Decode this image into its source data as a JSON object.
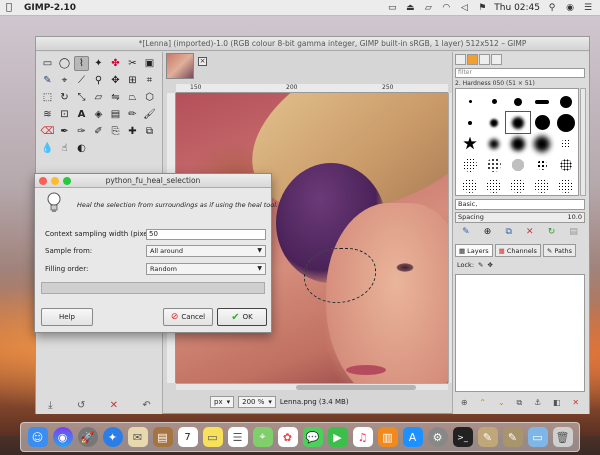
{
  "menubar": {
    "app_name": "GIMP-2.10",
    "clock": "Thu 02:45",
    "icons": [
      "apple-icon",
      "screen-icon",
      "eject-icon",
      "airplay-icon",
      "wifi-icon",
      "volume-icon",
      "flag-icon",
      "search-icon",
      "siri-icon",
      "list-icon"
    ]
  },
  "gimp": {
    "title": "*[Lenna] (imported)-1.0 (RGB colour 8-bit gamma integer, GIMP built-in sRGB, 1 layer) 512x512 – GIMP",
    "ruler_ticks": [
      "150",
      "200",
      "250"
    ],
    "status": {
      "unit": "px",
      "zoom": "200 %",
      "file_info": "Lenna.png (3.4 MB)"
    }
  },
  "toolbox": {
    "tools": [
      "rect-select-icon",
      "ellipse-select-icon",
      "free-select-icon",
      "fuzzy-select-icon",
      "color-select-icon",
      "scissors-icon",
      "foreground-select-icon",
      "paths-icon",
      "color-picker-icon",
      "measure-icon",
      "zoom-icon",
      "move-icon",
      "align-icon",
      "crop-icon",
      "unified-transform-icon",
      "rotate-icon",
      "scale-icon",
      "shear-icon",
      "flip-icon",
      "perspective-icon",
      "cage-icon",
      "warp-icon",
      "handle-icon",
      "text-icon",
      "bucket-fill-icon",
      "gradient-icon",
      "pencil-icon",
      "paintbrush-icon",
      "eraser-icon",
      "airbrush-icon",
      "ink-icon",
      "mypaint-icon",
      "clone-icon",
      "heal-icon",
      "perspective-clone-icon",
      "blur-icon",
      "smudge-icon",
      "dodge-icon"
    ]
  },
  "dock": {
    "filter_placeholder": "filter",
    "brush_name": "2. Hardness 050 (51 × 51)",
    "preset": "Basic,",
    "spacing_label": "Spacing",
    "spacing_value": "10.0",
    "tabs": [
      {
        "label": "Layers",
        "icon": "layers-icon"
      },
      {
        "label": "Channels",
        "icon": "channels-icon"
      },
      {
        "label": "Paths",
        "icon": "paths-icon"
      }
    ],
    "lock_label": "Lock:"
  },
  "dialog": {
    "title": "python_fu_heal_selection",
    "description": "Heal the selection from surroundings as if using the heal tool.",
    "fields": {
      "width_label": "Context sampling width (pixels):",
      "width_value": "50",
      "sample_label": "Sample from:",
      "sample_value": "All around",
      "order_label": "Filling order:",
      "order_value": "Random"
    },
    "buttons": {
      "help": "Help",
      "cancel": "Cancel",
      "ok": "OK"
    }
  },
  "mac_dock": {
    "apps": [
      "finder-icon",
      "siri-icon",
      "launchpad-icon",
      "safari-icon",
      "mail-icon",
      "notes-icon",
      "calendar-icon",
      "stickies-icon",
      "reminders-icon",
      "maps-icon",
      "photos-icon",
      "messages-icon",
      "facetime-icon",
      "music-icon",
      "books-icon",
      "appstore-icon",
      "settings-icon",
      "terminal-icon",
      "gimp-icon",
      "gimp-icon-2",
      "folder-icon",
      "trash-icon"
    ],
    "calendar_day": "7"
  },
  "colors": {
    "accent": "#f0a030",
    "traffic_red": "#fc5f57",
    "traffic_yellow": "#fdbc2e",
    "traffic_green": "#28c840"
  }
}
